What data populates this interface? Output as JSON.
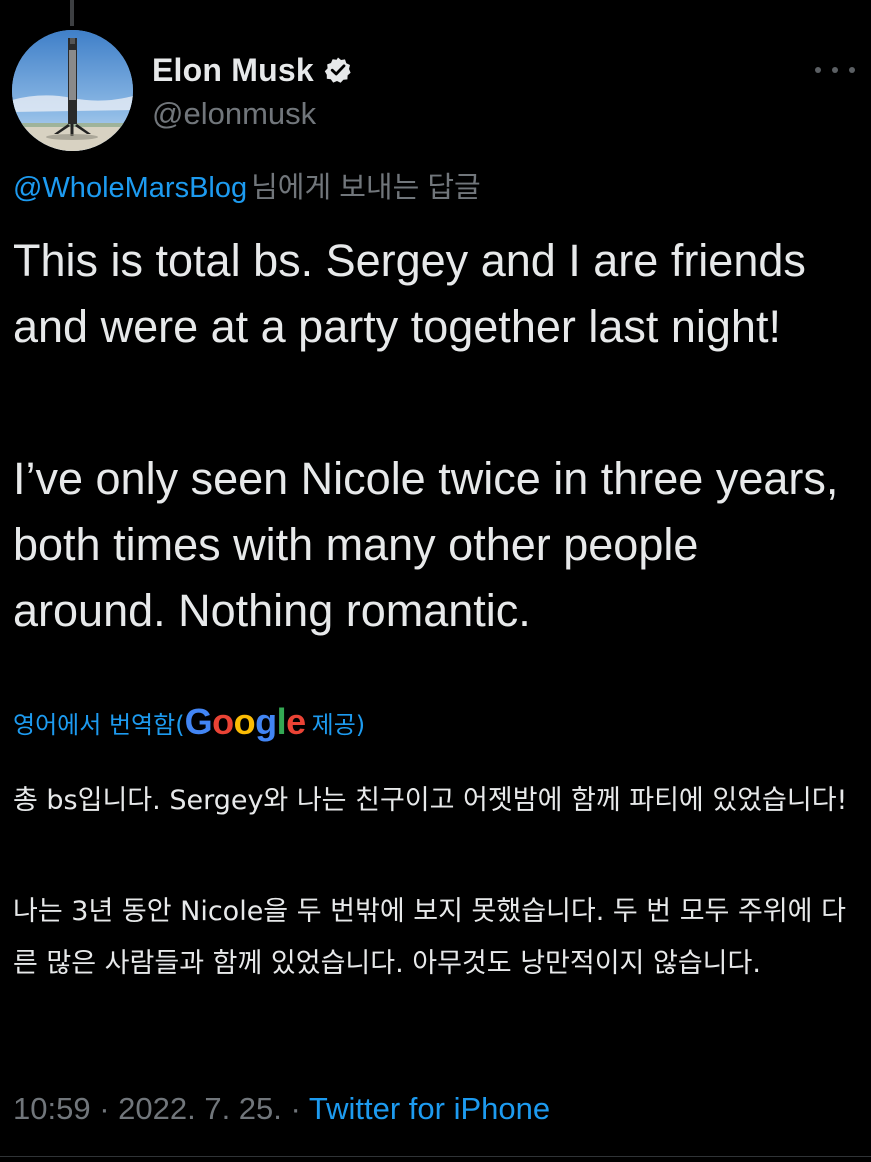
{
  "author": {
    "display_name": "Elon Musk",
    "handle": "@elonmusk",
    "verified": true,
    "avatar_icon": "rocket-booster-avatar"
  },
  "reply_context": {
    "mention": "@WholeMarsBlog",
    "suffix": "님에게 보내는 답글"
  },
  "tweet": {
    "paragraphs": [
      "This is total bs. Sergey and I are friends and were at a party together last night!",
      "I’ve only seen Nicole twice in three years, both times with many other people around. Nothing romantic."
    ]
  },
  "translation": {
    "label_prefix": "영어에서 번역함(",
    "provider_logo_text": "Google",
    "label_suffix": " 제공)",
    "paragraphs": [
      "총 bs입니다. Sergey와 나는 친구이고 어젯밤에 함께 파티에 있었습니다!",
      " 나는 3년 동안 Nicole을 두 번밖에 보지 못했습니다. 두 번 모두 주위에 다른 많은 사람들과 함께 있었습니다. 아무것도 낭만적이지 않습니다."
    ]
  },
  "meta": {
    "time": "10:59",
    "separator1": " · ",
    "date": "2022. 7. 25.",
    "separator2": " · ",
    "source": "Twitter for iPhone"
  },
  "colors": {
    "background": "#000000",
    "text_primary": "#e7e9ea",
    "text_secondary": "#71767b",
    "accent": "#1d9bf0"
  }
}
